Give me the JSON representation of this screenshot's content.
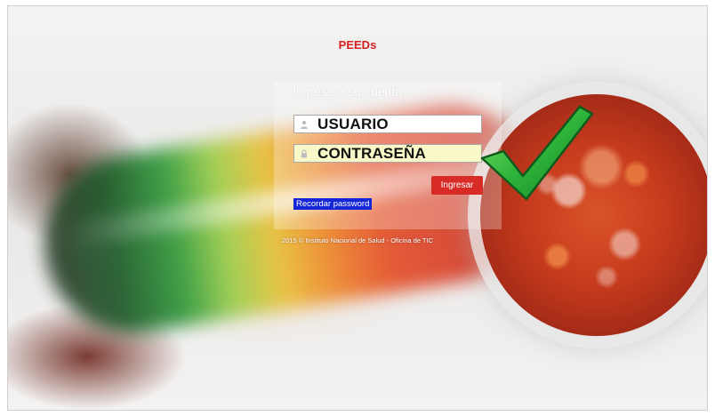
{
  "app": {
    "title": "PEEDs"
  },
  "login": {
    "heading": "Ingrese a su cuenta",
    "username_value": "USUARIO",
    "password_value": "CONTRASEÑA",
    "submit_label": "Ingresar",
    "remember_label": "Recordar password"
  },
  "footer": {
    "text": "2015 © Instituto Nacional de Salud - Oficina de TIC"
  },
  "icons": {
    "user": "user-icon",
    "lock": "lock-icon",
    "check": "checkmark-icon"
  },
  "colors": {
    "brand_red": "#d42020",
    "button_red": "#d92b26",
    "link_blue": "#1426d8",
    "check_green": "#2fb43a"
  }
}
